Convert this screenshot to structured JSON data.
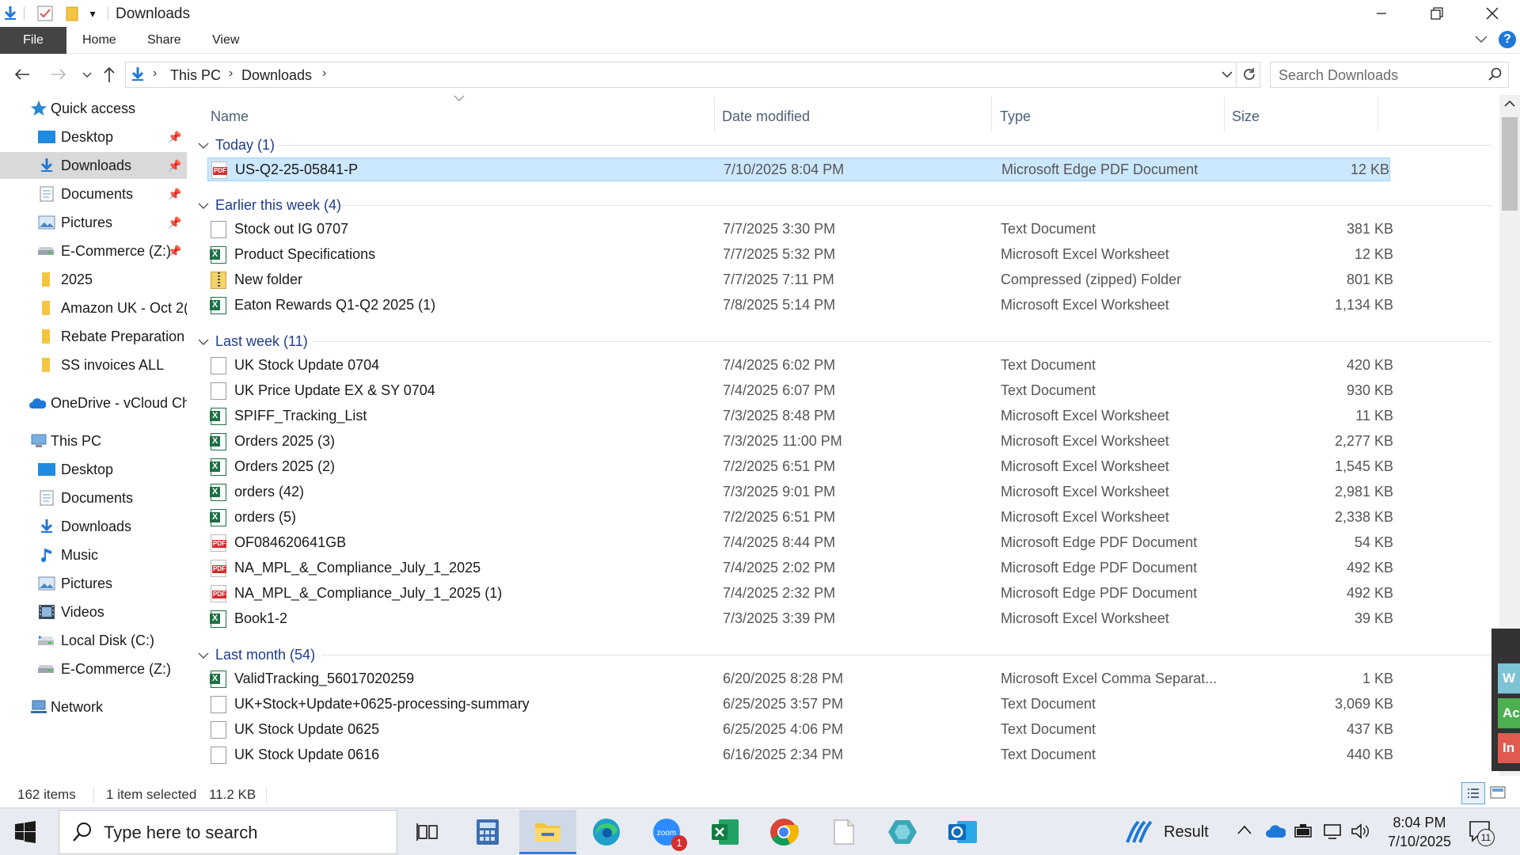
{
  "window": {
    "title": "Downloads",
    "qat_dropdown": "▾"
  },
  "ribbon": {
    "file": "File",
    "tabs": [
      "Home",
      "Share",
      "View"
    ]
  },
  "address": {
    "crumbs": [
      "This PC",
      "Downloads"
    ],
    "search_placeholder": "Search Downloads"
  },
  "nav": {
    "quick_access": "Quick access",
    "items": [
      {
        "label": "Desktop",
        "icon": "desktop-folder-icon",
        "pinned": true
      },
      {
        "label": "Downloads",
        "icon": "downloads-folder-icon",
        "pinned": true,
        "selected": true
      },
      {
        "label": "Documents",
        "icon": "documents-folder-icon",
        "pinned": true
      },
      {
        "label": "Pictures",
        "icon": "pictures-folder-icon",
        "pinned": true
      },
      {
        "label": "E-Commerce (Z:)",
        "icon": "network-drive-icon",
        "pinned": true
      },
      {
        "label": "2025",
        "icon": "folder-icon"
      },
      {
        "label": "Amazon UK - Oct 2(",
        "icon": "folder-icon"
      },
      {
        "label": "Rebate Preparation",
        "icon": "folder-icon"
      },
      {
        "label": "SS invoices ALL",
        "icon": "folder-icon"
      }
    ],
    "onedrive": "OneDrive - vCloud Ch",
    "this_pc": "This PC",
    "pc_items": [
      {
        "label": "Desktop",
        "icon": "desktop-folder-icon"
      },
      {
        "label": "Documents",
        "icon": "documents-folder-icon"
      },
      {
        "label": "Downloads",
        "icon": "downloads-folder-icon"
      },
      {
        "label": "Music",
        "icon": "music-icon"
      },
      {
        "label": "Pictures",
        "icon": "pictures-folder-icon"
      },
      {
        "label": "Videos",
        "icon": "videos-icon"
      },
      {
        "label": "Local Disk (C:)",
        "icon": "local-disk-icon"
      },
      {
        "label": "E-Commerce (Z:)",
        "icon": "network-drive-icon"
      }
    ],
    "network": "Network"
  },
  "columns": {
    "name": "Name",
    "date": "Date modified",
    "type": "Type",
    "size": "Size"
  },
  "groups": [
    {
      "header": "Today (1)",
      "files": [
        {
          "name": "US-Q2-25-05841-P",
          "date": "7/10/2025 8:04 PM",
          "type": "Microsoft Edge PDF Document",
          "size": "12 KB",
          "kind": "pdf",
          "selected": true
        }
      ]
    },
    {
      "header": "Earlier this week (4)",
      "files": [
        {
          "name": "Stock out IG 0707",
          "date": "7/7/2025 3:30 PM",
          "type": "Text Document",
          "size": "381 KB",
          "kind": "txt"
        },
        {
          "name": "Product Specifications",
          "date": "7/7/2025 5:32 PM",
          "type": "Microsoft Excel Worksheet",
          "size": "12 KB",
          "kind": "xls"
        },
        {
          "name": "New folder",
          "date": "7/7/2025 7:11 PM",
          "type": "Compressed (zipped) Folder",
          "size": "801 KB",
          "kind": "zip"
        },
        {
          "name": "Eaton Rewards Q1-Q2 2025 (1)",
          "date": "7/8/2025 5:14 PM",
          "type": "Microsoft Excel Worksheet",
          "size": "1,134 KB",
          "kind": "xls"
        }
      ]
    },
    {
      "header": "Last week (11)",
      "files": [
        {
          "name": "UK Stock Update 0704",
          "date": "7/4/2025 6:02 PM",
          "type": "Text Document",
          "size": "420 KB",
          "kind": "txt"
        },
        {
          "name": "UK Price Update EX & SY 0704",
          "date": "7/4/2025 6:07 PM",
          "type": "Text Document",
          "size": "930 KB",
          "kind": "txt"
        },
        {
          "name": "SPIFF_Tracking_List",
          "date": "7/3/2025 8:48 PM",
          "type": "Microsoft Excel Worksheet",
          "size": "11 KB",
          "kind": "xls"
        },
        {
          "name": "Orders 2025 (3)",
          "date": "7/3/2025 11:00 PM",
          "type": "Microsoft Excel Worksheet",
          "size": "2,277 KB",
          "kind": "xls"
        },
        {
          "name": "Orders 2025 (2)",
          "date": "7/2/2025 6:51 PM",
          "type": "Microsoft Excel Worksheet",
          "size": "1,545 KB",
          "kind": "xls"
        },
        {
          "name": "orders (42)",
          "date": "7/3/2025 9:01 PM",
          "type": "Microsoft Excel Worksheet",
          "size": "2,981 KB",
          "kind": "xls"
        },
        {
          "name": "orders (5)",
          "date": "7/2/2025 6:51 PM",
          "type": "Microsoft Excel Worksheet",
          "size": "2,338 KB",
          "kind": "xls"
        },
        {
          "name": "OF084620641GB",
          "date": "7/4/2025 8:44 PM",
          "type": "Microsoft Edge PDF Document",
          "size": "54 KB",
          "kind": "pdf"
        },
        {
          "name": "NA_MPL_&_Compliance_July_1_2025",
          "date": "7/4/2025 2:02 PM",
          "type": "Microsoft Edge PDF Document",
          "size": "492 KB",
          "kind": "pdf"
        },
        {
          "name": "NA_MPL_&_Compliance_July_1_2025 (1)",
          "date": "7/4/2025 2:32 PM",
          "type": "Microsoft Edge PDF Document",
          "size": "492 KB",
          "kind": "pdf"
        },
        {
          "name": "Book1-2",
          "date": "7/3/2025 3:39 PM",
          "type": "Microsoft Excel Worksheet",
          "size": "39 KB",
          "kind": "xls"
        }
      ]
    },
    {
      "header": "Last month (54)",
      "files": [
        {
          "name": "ValidTracking_56017020259",
          "date": "6/20/2025 8:28 PM",
          "type": "Microsoft Excel Comma Separat...",
          "size": "1 KB",
          "kind": "xls"
        },
        {
          "name": "UK+Stock+Update+0625-processing-summary",
          "date": "6/25/2025 3:57 PM",
          "type": "Text Document",
          "size": "3,069 KB",
          "kind": "txt"
        },
        {
          "name": "UK Stock Update 0625",
          "date": "6/25/2025 4:06 PM",
          "type": "Text Document",
          "size": "437 KB",
          "kind": "txt"
        },
        {
          "name": "UK Stock Update 0616",
          "date": "6/16/2025 2:34 PM",
          "type": "Text Document",
          "size": "440 KB",
          "kind": "txt"
        }
      ]
    }
  ],
  "status": {
    "items": "162 items",
    "selected": "1 item selected",
    "size": "11.2 KB"
  },
  "taskbar": {
    "search_placeholder": "Type here to search",
    "zoom_badge": "1",
    "weather": "Result",
    "time": "8:04 PM",
    "date": "7/10/2025",
    "notif_count": "11"
  },
  "side_widget": [
    "W",
    "Ac",
    "In"
  ],
  "colors": {
    "selection": "#cce8ff",
    "group_header": "#1e3c8c",
    "accent": "#0078d7"
  }
}
